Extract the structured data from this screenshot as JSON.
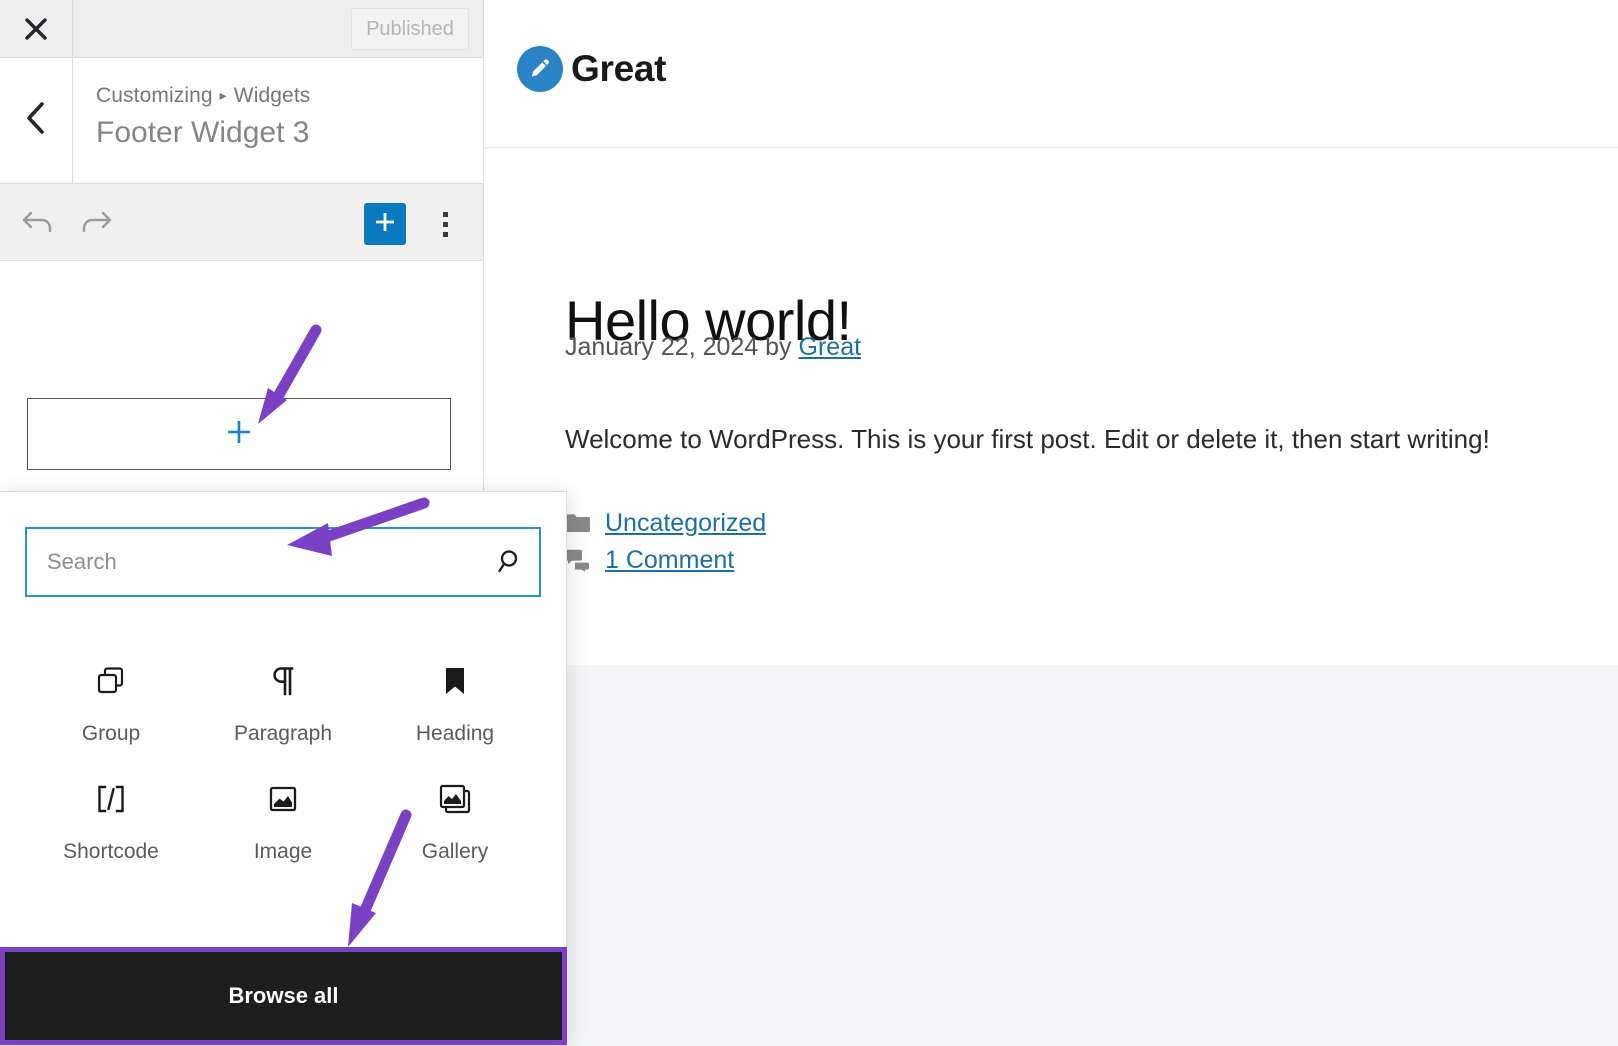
{
  "customizer": {
    "close_icon": "close-x-icon",
    "publish_button": "Published",
    "back_icon": "chevron-left-icon",
    "breadcrumb": {
      "root": "Customizing",
      "separator": "▸",
      "section": "Widgets"
    },
    "panel_title": "Footer Widget 3"
  },
  "block_toolbar": {
    "undo_icon": "undo-arrow-icon",
    "redo_icon": "redo-arrow-icon",
    "add_block_icon": "plus-icon",
    "more_options_icon": "vertical-ellipsis-icon"
  },
  "widget_canvas": {
    "add_block_placeholder_icon": "plus-icon"
  },
  "inserter": {
    "search": {
      "placeholder": "Search",
      "value": "",
      "icon": "search-magnifier-icon"
    },
    "blocks": [
      {
        "label": "Group",
        "icon": "group-blocks-icon"
      },
      {
        "label": "Paragraph",
        "icon": "pilcrow-icon"
      },
      {
        "label": "Heading",
        "icon": "bookmark-icon"
      },
      {
        "label": "Shortcode",
        "icon": "shortcode-brackets-icon"
      },
      {
        "label": "Image",
        "icon": "image-icon"
      },
      {
        "label": "Gallery",
        "icon": "gallery-stacked-images-icon"
      }
    ],
    "browse_all_label": "Browse all"
  },
  "preview": {
    "site": {
      "title": "Great",
      "logo_icon": "pencil-edit-icon"
    },
    "post": {
      "title": "Hello world!",
      "meta_date": "January 22, 2024",
      "meta_by": "by",
      "meta_author": "Great",
      "body": "Welcome to WordPress. This is your first post. Edit or delete it, then start writing!",
      "taxonomy": [
        {
          "label": "Uncategorized",
          "icon": "folder-icon"
        },
        {
          "label": "1 Comment",
          "icon": "comment-bubble-icon"
        }
      ]
    }
  },
  "colors": {
    "accent_blue": "#0a7ac0",
    "link_blue": "#1a6fa8",
    "annotation_purple": "#7a41c5",
    "browse_all_bg": "#1e1e1e",
    "search_border": "#2a8fd4",
    "preview_bg": "#f5f6f7"
  }
}
